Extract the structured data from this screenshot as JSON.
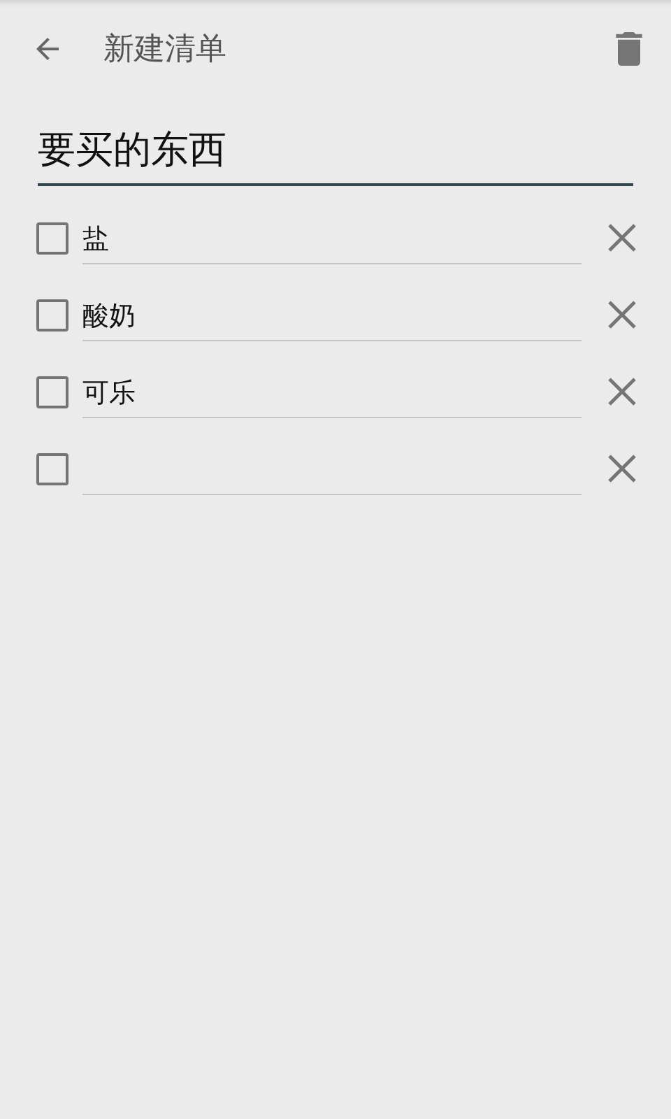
{
  "toolbar": {
    "title": "新建清单"
  },
  "list_title": {
    "value": "要买的东西"
  },
  "items": [
    {
      "text": "盐",
      "checked": false
    },
    {
      "text": "酸奶",
      "checked": false
    },
    {
      "text": "可乐",
      "checked": false
    },
    {
      "checked": false
    }
  ]
}
